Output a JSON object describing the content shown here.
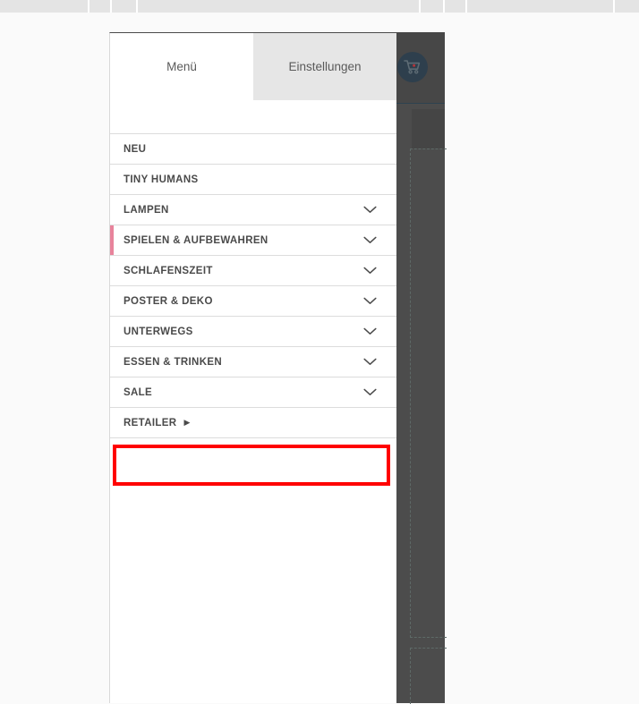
{
  "top_bar": {
    "divider_positions": [
      98,
      123,
      152,
      468,
      495,
      520,
      685
    ]
  },
  "overlay": {
    "cart_icon": "shopping-cart-icon",
    "cart_badge_color": "#2e3f4d",
    "cart_dot_color": "#b5343a",
    "overlay_color": "#4c4c4c"
  },
  "panel": {
    "tabs": [
      {
        "label": "Menü",
        "active": true
      },
      {
        "label": "Einstellungen",
        "active": false
      }
    ],
    "accent_color": "#e8839b",
    "nav_items": [
      {
        "label": "NEU",
        "chevron": false,
        "external": false,
        "active": false
      },
      {
        "label": "TINY HUMANS",
        "chevron": false,
        "external": false,
        "active": false
      },
      {
        "label": "LAMPEN",
        "chevron": true,
        "external": false,
        "active": false
      },
      {
        "label": "SPIELEN & AUFBEWAHREN",
        "chevron": true,
        "external": false,
        "active": true
      },
      {
        "label": "SCHLAFENSZEIT",
        "chevron": true,
        "external": false,
        "active": false
      },
      {
        "label": "POSTER & DEKO",
        "chevron": true,
        "external": false,
        "active": false
      },
      {
        "label": "UNTERWEGS",
        "chevron": true,
        "external": false,
        "active": false
      },
      {
        "label": "ESSEN & TRINKEN",
        "chevron": true,
        "external": false,
        "active": false
      },
      {
        "label": "SALE",
        "chevron": true,
        "external": false,
        "active": false
      },
      {
        "label": "RETAILER",
        "chevron": false,
        "external": true,
        "active": false,
        "arrow_glyph": "▶"
      }
    ]
  },
  "annotation": {
    "border_color": "#ff0000",
    "label": ""
  }
}
